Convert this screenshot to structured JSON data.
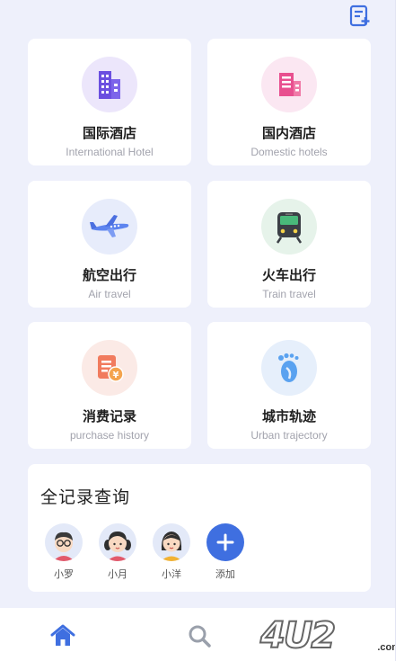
{
  "cards": [
    {
      "cn": "国际酒店",
      "en": "International Hotel",
      "icon": "building-icon",
      "circle_color": "#ece6fb"
    },
    {
      "cn": "国内酒店",
      "en": "Domestic hotels",
      "icon": "hotel-icon",
      "circle_color": "#fbe7f2"
    },
    {
      "cn": "航空出行",
      "en": "Air travel",
      "icon": "airplane-icon",
      "circle_color": "#e7ecfb"
    },
    {
      "cn": "火车出行",
      "en": "Train travel",
      "icon": "train-icon",
      "circle_color": "#e6f3ea"
    },
    {
      "cn": "消费记录",
      "en": "purchase history",
      "icon": "receipt-icon",
      "circle_color": "#fbeae6"
    },
    {
      "cn": "城市轨迹",
      "en": "Urban trajectory",
      "icon": "footprint-icon",
      "circle_color": "#e6effb"
    }
  ],
  "records": {
    "title": "全记录查询",
    "people": [
      "小罗",
      "小月",
      "小洋"
    ],
    "add_label": "添加"
  },
  "watermark": {
    "text": "4U2",
    "domain": ".com"
  },
  "colors": {
    "accent": "#3f6fe0",
    "background": "#eef0fb"
  }
}
